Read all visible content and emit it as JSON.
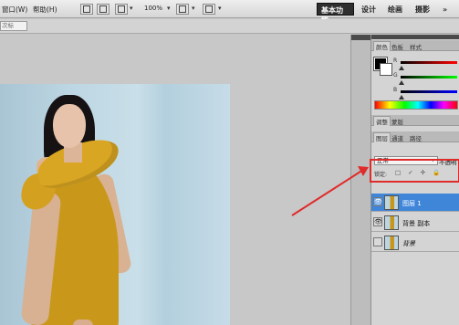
{
  "menubar": {
    "menus": [
      "窗口(W)",
      "帮助(H)"
    ],
    "zoom": "100%",
    "workspaces": [
      "基本功能",
      "设计",
      "绘画",
      "摄影"
    ],
    "more": "»"
  },
  "options": {
    "field_text": "次标"
  },
  "color_panel": {
    "tabs": [
      "颜色",
      "色板",
      "样式"
    ],
    "channels": [
      {
        "label": "R",
        "value": 0,
        "gradient": [
          "#000000",
          "#ff0000"
        ]
      },
      {
        "label": "G",
        "value": 0,
        "gradient": [
          "#000000",
          "#00ff00"
        ]
      },
      {
        "label": "B",
        "value": 0,
        "gradient": [
          "#000000",
          "#0000ff"
        ]
      }
    ],
    "foreground": "#000000",
    "background": "#ffffff"
  },
  "adjust_tabs": [
    "调整",
    "蒙版"
  ],
  "layers_panel": {
    "tabs": [
      "图层",
      "通道",
      "路径"
    ],
    "blend_mode": "正常",
    "opacity_label": "不透明",
    "lock_label": "锁定:",
    "lock_icons": "□ ✓ ✢ 🔒",
    "layers": [
      {
        "name": "图层 1",
        "selected": true,
        "visible": true,
        "italic": false
      },
      {
        "name": "背景 副本",
        "selected": false,
        "visible": true,
        "italic": false
      },
      {
        "name": "背景",
        "selected": false,
        "visible": false,
        "italic": true
      }
    ]
  },
  "annotation": {
    "color": "#e02b2b"
  }
}
